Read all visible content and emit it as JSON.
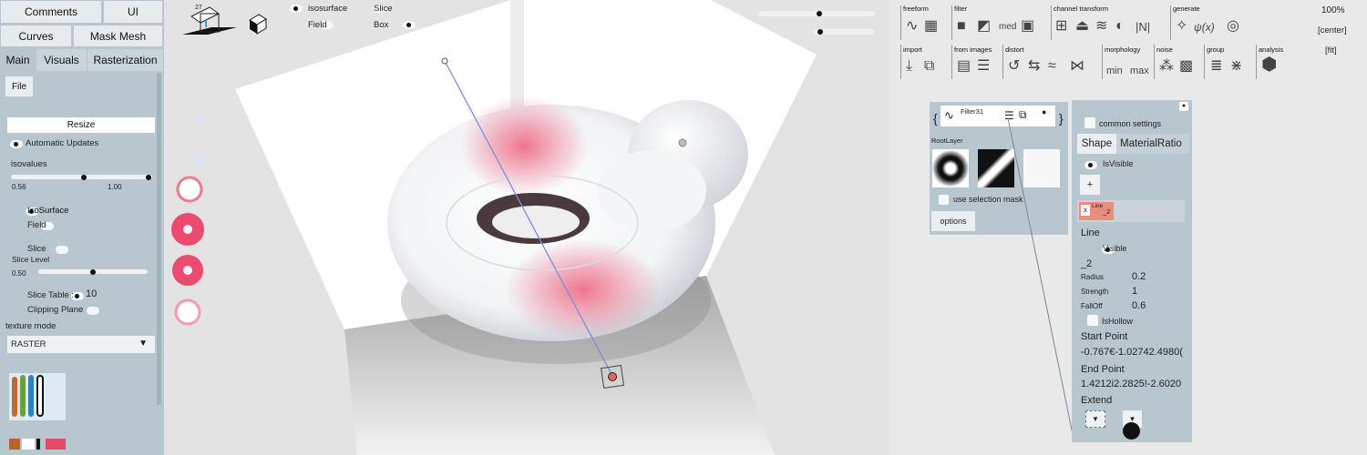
{
  "left_panel": {
    "top_buttons": [
      "Comments",
      "UI",
      "Curves",
      "Mask Mesh"
    ],
    "tabs": [
      "Main",
      "Visuals",
      "Rasterization"
    ],
    "file_tab": "File",
    "resize_label": "Resize",
    "automatic_updates": "Automatic Updates",
    "isovalues_label": "isovalues",
    "iso_min": "0.56",
    "iso_max": "1.00",
    "isosurface": "IsoSurface",
    "field": "Field",
    "slice": "Slice",
    "slice_level": "Slice Level",
    "slice_level_value": "0.50",
    "slice_table": "Slice Table :",
    "slice_table_value": "10",
    "clipping_plane": "Clipping Plane",
    "texture_mode_label": "texture mode",
    "texture_mode_value": "RASTER"
  },
  "viewport": {
    "frame_number": "27",
    "toggle_isosurface": "isosurface",
    "toggle_slice": "Slice",
    "toggle_field": "Field",
    "toggle_box": "Box"
  },
  "toolbar": {
    "groups": [
      "freeform",
      "filter",
      "channel transform",
      "generate",
      "import",
      "from images",
      "distort",
      "morphology",
      "noise",
      "group",
      "analysis"
    ],
    "filter_med": "med",
    "morph_min": "min",
    "morph_max": "max",
    "channel_N": "|N|",
    "generate_psi": "ψ(x)",
    "zoom": "100%",
    "center": "[center]",
    "fit": "[fit]"
  },
  "filter_panel": {
    "filter_name": "Filter31",
    "root_layer": "RootLayer",
    "use_selection_mask": "use selection mask",
    "options": "options"
  },
  "shape_panel": {
    "common_settings": "common settings",
    "tab_shape": "Shape",
    "tab_material": "MaterialRatio",
    "is_visible": "IsVisible",
    "add": "+",
    "item_close": "x",
    "item_label": "Line",
    "item_suffix": "_2",
    "line_header": "Line",
    "visible": "Visible",
    "name": "_2",
    "radius_label": "Radius",
    "radius_value": "0.2",
    "strength_label": "Strength",
    "strength_value": "1",
    "falloff_label": "FallOff",
    "falloff_value": "0.6",
    "is_hollow": "IsHollow",
    "start_point_label": "Start Point",
    "start_point_value": "-0.767€-1.02742.4980(",
    "end_point_label": "End Point",
    "end_point_value": "1.4212i2.2825!-2.6020",
    "extend_label": "Extend"
  },
  "colors": {
    "panel_bg": "#b8c6cf",
    "viewport_bg": "#e3e3e3",
    "accent_pink": "#e8708a",
    "selected_item": "#e88a7e"
  }
}
